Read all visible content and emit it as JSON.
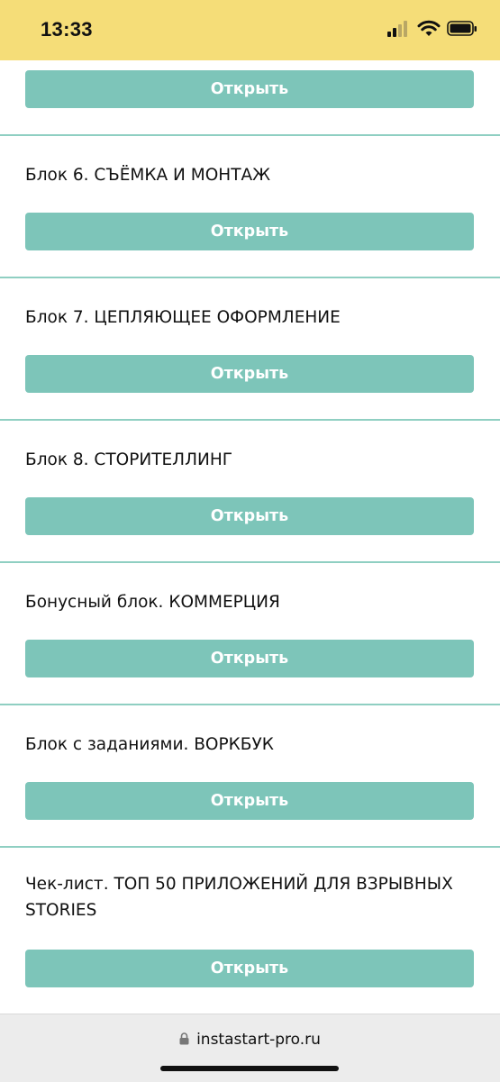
{
  "status_bar": {
    "time": "13:33"
  },
  "sections": [
    {
      "title": "",
      "button_label": "Открыть"
    },
    {
      "title": "Блок 6. СЪЁМКА И МОНТАЖ",
      "button_label": "Открыть"
    },
    {
      "title": "Блок 7. ЦЕПЛЯЮЩЕЕ ОФОРМЛЕНИЕ",
      "button_label": "Открыть"
    },
    {
      "title": "Блок 8. СТОРИТЕЛЛИНГ",
      "button_label": "Открыть"
    },
    {
      "title": "Бонусный блок. КОММЕРЦИЯ",
      "button_label": "Открыть"
    },
    {
      "title": "Блок с заданиями. ВОРКБУК",
      "button_label": "Открыть"
    },
    {
      "title": "Чек-лист. ТОП 50 ПРИЛОЖЕНИЙ ДЛЯ ВЗРЫВНЫХ STORIES",
      "button_label": "Открыть"
    }
  ],
  "browser": {
    "url": "instastart-pro.ru"
  },
  "colors": {
    "status_bar": "#f5dd78",
    "button": "#7dc5b9",
    "divider": "#8fcfc2"
  },
  "icons": [
    "signal-icon",
    "wifi-icon",
    "battery-icon",
    "lock-icon"
  ]
}
